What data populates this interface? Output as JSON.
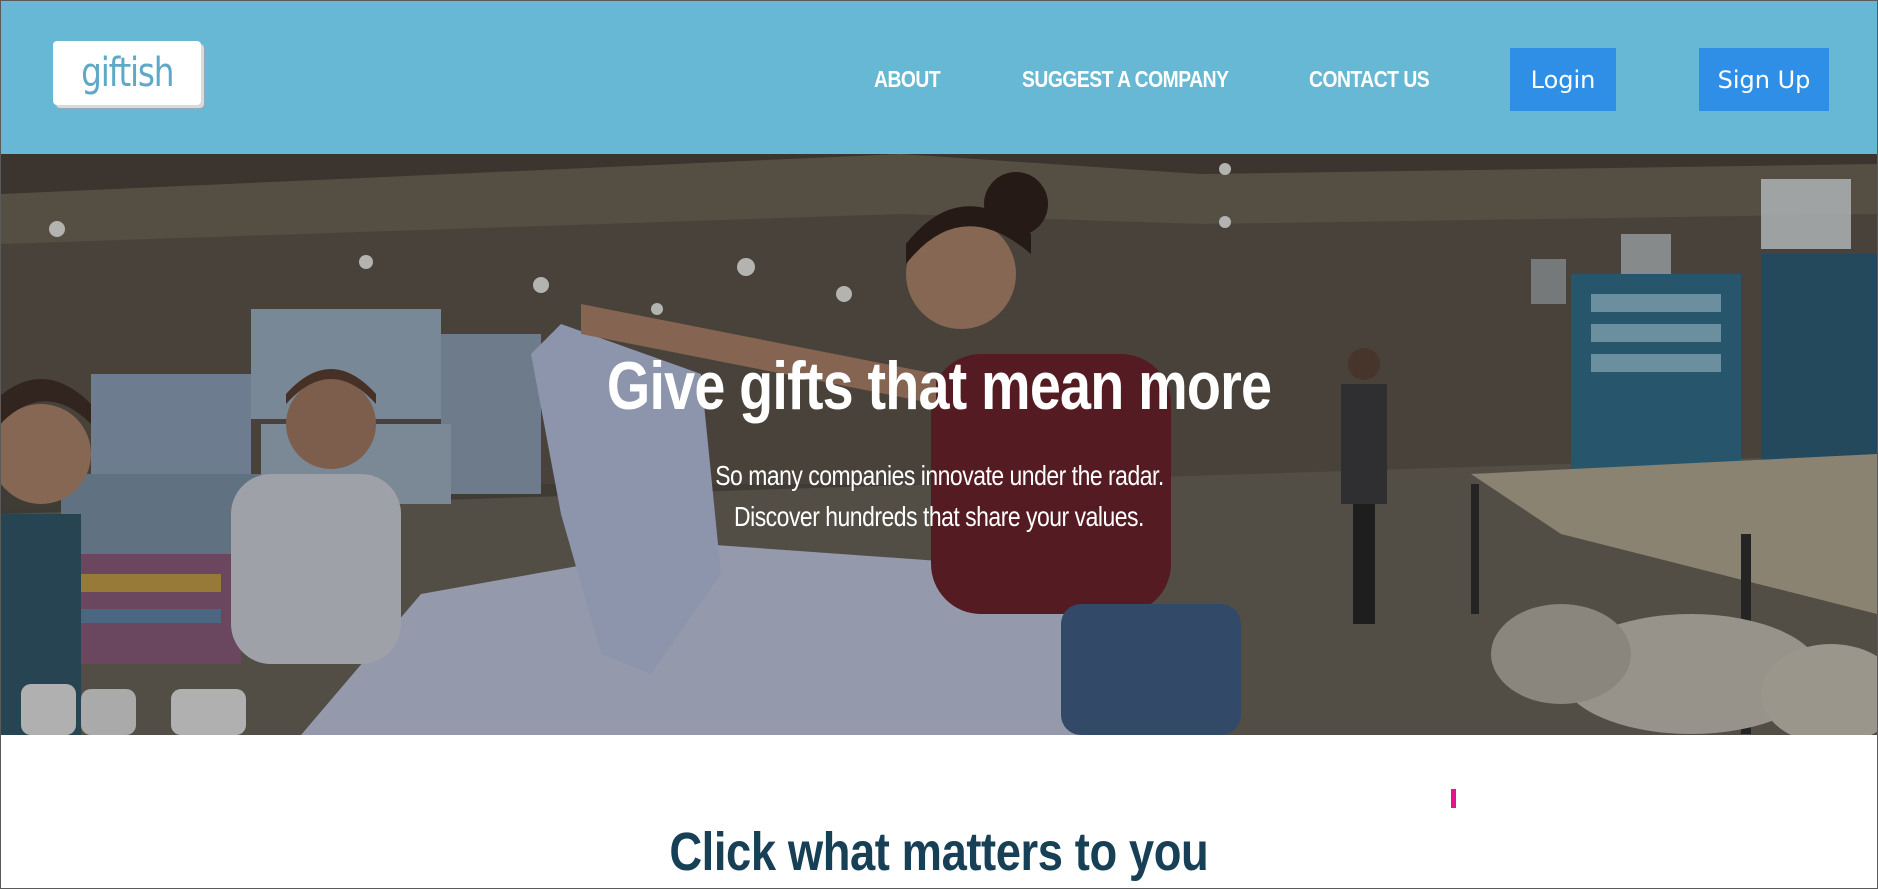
{
  "header": {
    "logo": "giftish",
    "nav": {
      "about": "ABOUT",
      "suggest": "SUGGEST A COMPANY",
      "contact": "CONTACT US"
    },
    "buttons": {
      "login": "Login",
      "signup": "Sign Up"
    }
  },
  "hero": {
    "title": "Give gifts that mean more",
    "subtitle_line1": "So many companies innovate under the radar.",
    "subtitle_line2": "Discover hundreds that share your values."
  },
  "section": {
    "title": "Click what matters to you"
  },
  "colors": {
    "header_bg": "#66b8d4",
    "button_bg": "#2f8fe6",
    "section_title": "#173f55",
    "marker": "#e0168a"
  }
}
